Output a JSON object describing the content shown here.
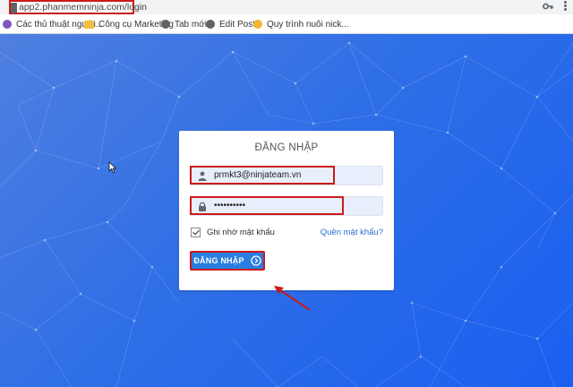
{
  "browser": {
    "url": "app2.phanmemninja.com/login",
    "bookmarks": [
      {
        "label": "Các thủ thuật người..."
      },
      {
        "label": "Công cụ Marketing"
      },
      {
        "label": "Tab mới"
      },
      {
        "label": "Edit Post"
      },
      {
        "label": "Quy trình nuôi nick..."
      }
    ]
  },
  "login": {
    "title": "ĐĂNG NHẬP",
    "email_value": "prmkt3@ninjateam.vn",
    "password_value": "••••••••••",
    "remember_label": "Ghi nhớ mật khẩu",
    "remember_checked": true,
    "forgot_label": "Quên mật khẩu?",
    "submit_label": "ĐĂNG NHẬP"
  },
  "colors": {
    "background_accent": "#2f6fe6",
    "button": "#2a7ee0",
    "highlight": "#cc1a1a",
    "link": "#2a6fd6"
  }
}
